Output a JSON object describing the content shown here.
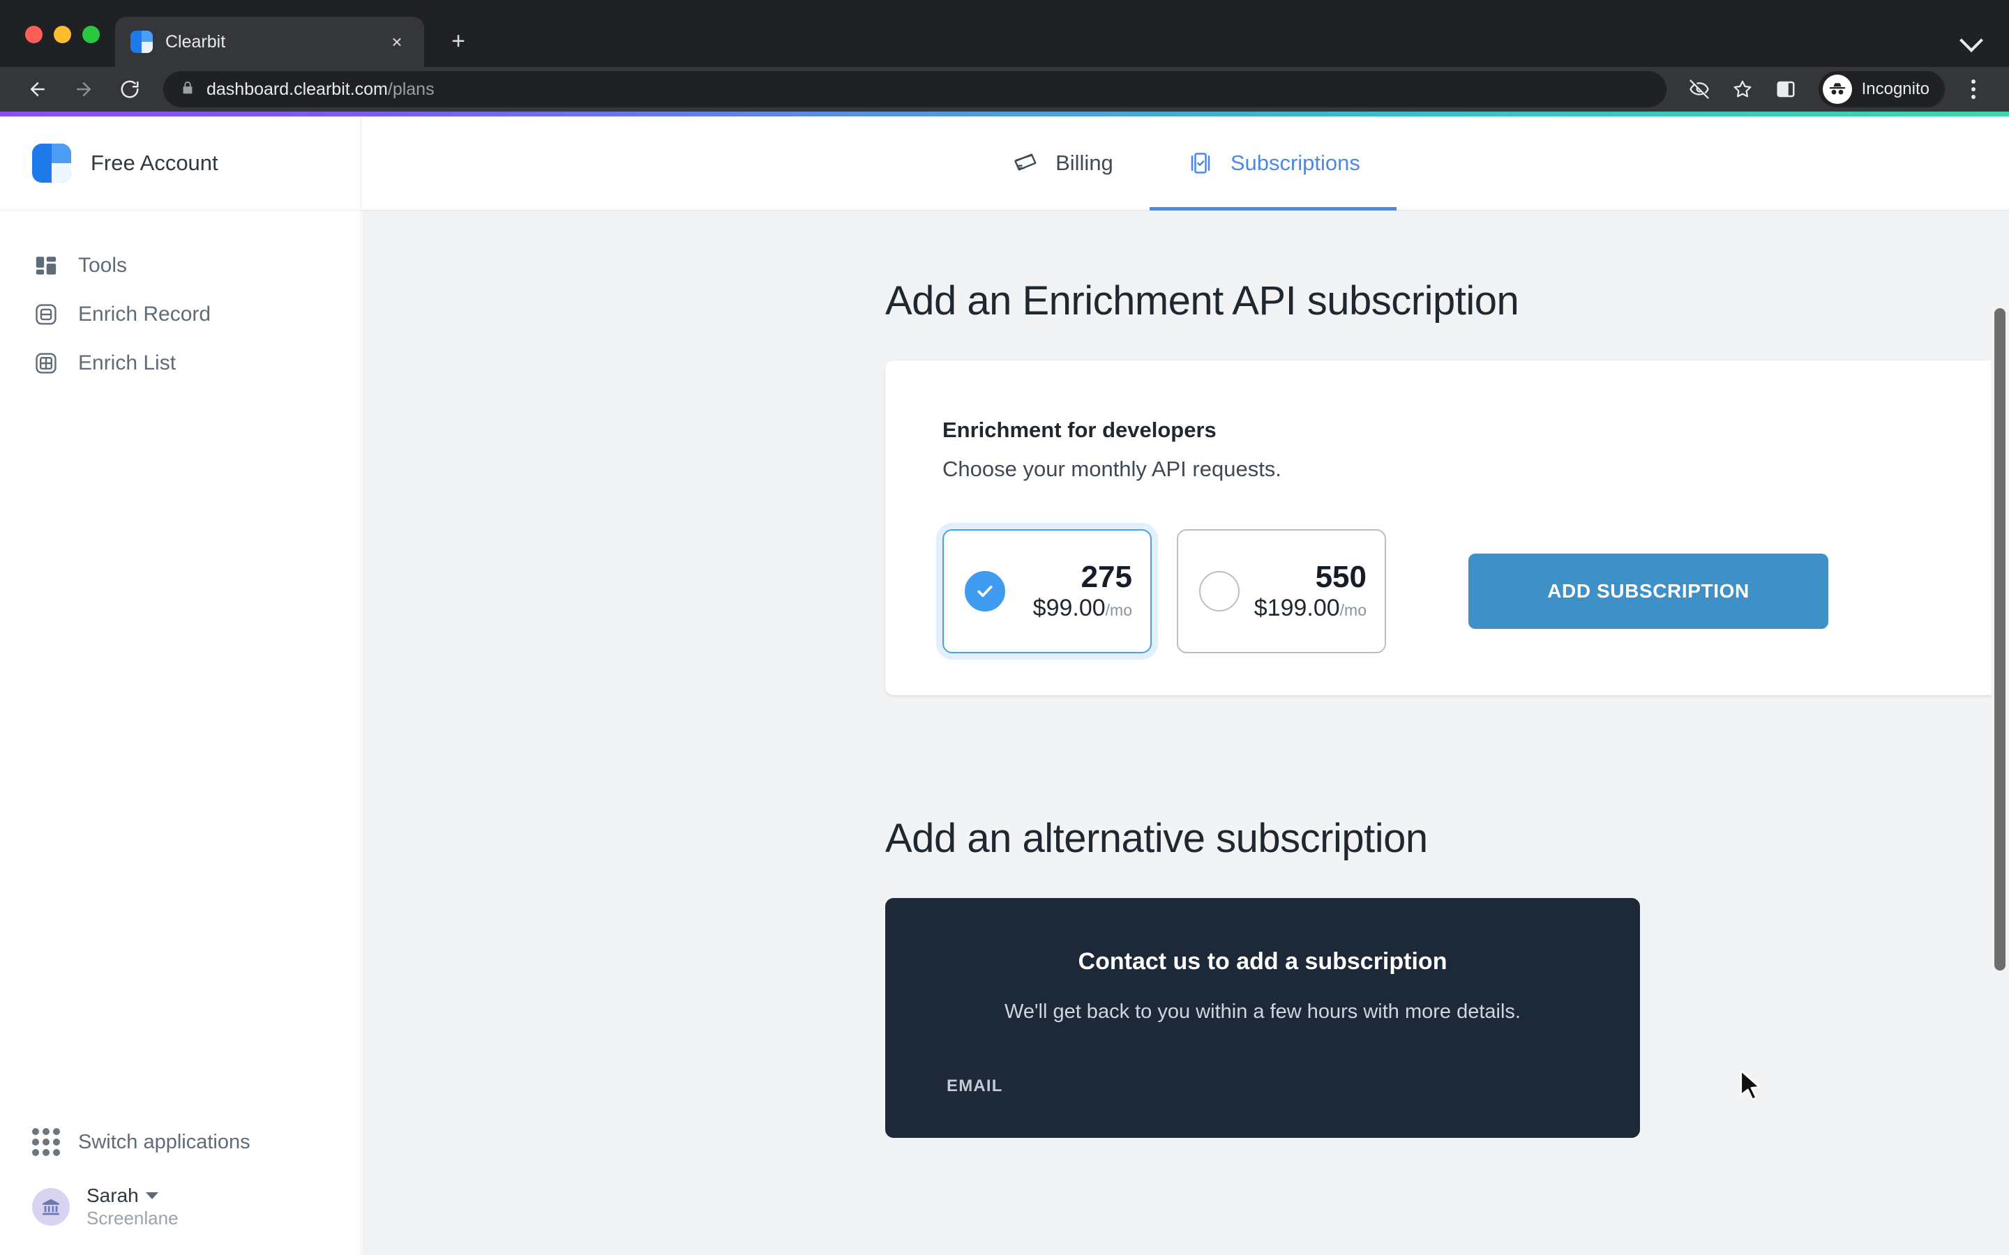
{
  "browser": {
    "tab": {
      "title": "Clearbit",
      "favicon": "clearbit-logo-icon",
      "close": "×"
    },
    "new_tab_label": "+",
    "tabstrip_expand": "chevron-down-icon",
    "url": {
      "domain": "dashboard.clearbit.com",
      "path": "/plans"
    },
    "omnibox_icons": [
      "lock-icon",
      "view-off-icon",
      "star-icon"
    ],
    "toolbar_icons": [
      "back-arrow-icon",
      "forward-arrow-icon",
      "reload-icon",
      "side-panel-icon"
    ],
    "profile": {
      "label": "Incognito",
      "icon": "incognito-icon"
    },
    "menu": "kebab-menu-icon"
  },
  "sidebar": {
    "brand": {
      "name": "Free Account",
      "logo": "clearbit-logo-icon"
    },
    "items": [
      {
        "label": "Tools",
        "icon": "dashboard-tiles-icon"
      },
      {
        "label": "Enrich Record",
        "icon": "enrich-record-icon"
      },
      {
        "label": "Enrich List",
        "icon": "enrich-list-icon"
      }
    ],
    "switch_applications": {
      "label": "Switch applications",
      "icon": "grid-apps-icon"
    },
    "user": {
      "name": "Sarah",
      "org": "Screenlane",
      "avatar": "bank-building-icon",
      "caret": "chevron-down-icon"
    }
  },
  "tabs": [
    {
      "label": "Billing",
      "icon": "credit-card-icon",
      "active": false
    },
    {
      "label": "Subscriptions",
      "icon": "subscription-check-icon",
      "active": true
    }
  ],
  "main": {
    "heading": "Add an Enrichment API subscription",
    "card": {
      "title": "Enrichment for developers",
      "subtitle": "Choose your monthly API requests.",
      "options": [
        {
          "count": "275",
          "price": "$99.00",
          "period": "/mo",
          "selected": true
        },
        {
          "count": "550",
          "price": "$199.00",
          "period": "/mo",
          "selected": false
        }
      ],
      "submit_label": "ADD SUBSCRIPTION"
    },
    "alt_heading": "Add an alternative subscription",
    "contact": {
      "title": "Contact us to add a subscription",
      "subtitle": "We'll get back to you within a few hours with more details.",
      "email_label": "EMAIL"
    }
  },
  "colors": {
    "accent_blue": "#4a89e8",
    "button_blue": "#4090c8",
    "radio_blue": "#3f9bef",
    "dark_card": "#1d2838",
    "gradient_start": "#8b4ff0",
    "gradient_end": "#3ed6a8"
  }
}
